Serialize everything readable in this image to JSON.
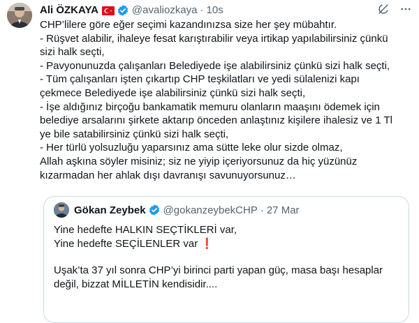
{
  "author": {
    "name": "Ali ÖZKAYA",
    "handle": "@avaliozkaya",
    "separator": "·",
    "time": "10s"
  },
  "tweet": {
    "lines": [
      "CHP’lilere göre eğer seçimi kazandınızsa size her şey mübahtır.",
      "- Rüşvet alabilir, ihaleye fesat karıştırabilir veya irtikap yapılabilirsiniz çünkü",
      "sizi halk seçti,",
      "- Pavyonunuzda çalışanları Belediyede işe alabilirsiniz çünkü sizi halk seçti,",
      "- Tüm çalışanları işten çıkartıp CHP teşkilatları ve yedi sülalenizi kapı",
      "çekmece Belediyede işe alabilirsiniz çünkü sizi halk seçti,",
      "- İşe aldığınız birçoğu bankamatik memuru olanların maaşını ödemek için",
      "belediye arsalarını şirkete aktarıp önceden anlaştınız kişilere ihalesiz ve 1 Tl",
      "ye bile satabilirsiniz çünkü sizi halk seçti,",
      "- Her türlü yolsuzluğu yaparsınız ama sütte leke olur sizde olmaz,",
      "Allah aşkına söyler misiniz; siz ne yiyip içeriyorsunuz da hiç yüzünüz",
      "kızarmadan her ahlak dışı davranışı savunuyorsunuz…"
    ]
  },
  "quote": {
    "name": "Gökan Zeybek",
    "handle": "@gokanzeybekCHP",
    "separator": "·",
    "time": "27 Mar",
    "line1": "Yine hedefte HALKIN SEÇTİKLERİ var,",
    "line2": "Yine hedefte SEÇİLENLER var",
    "line2_emoji": "❗",
    "line3": "Uşak’ta 37 yıl sonra CHP’yi birinci parti yapan güç, masa başı hesaplar",
    "line4": "değil, bizzat MİLLETİN kendisidir...."
  },
  "icons": {
    "verified": "verified-badge-icon",
    "flag": "turkey-flag-icon",
    "grok": "grok-icon",
    "more": "more-options-icon"
  },
  "colors": {
    "verified": "#1d9bf0",
    "flag_red": "#e30a17",
    "secondary_text": "#536471",
    "border": "#cfd9de"
  }
}
